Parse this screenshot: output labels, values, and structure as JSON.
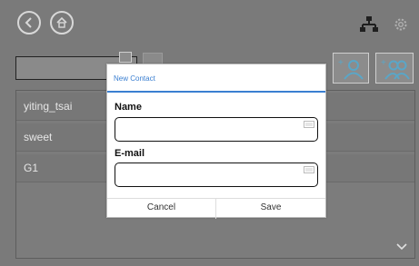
{
  "icons": {
    "back": "back-icon",
    "home": "home-icon",
    "network": "network-icon",
    "settings": "gear-icon",
    "add_contact": "add-user-icon",
    "add_group": "add-group-icon",
    "scroll": "chevron-down-icon"
  },
  "contacts": [
    {
      "name": "yiting_tsai"
    },
    {
      "name": "sweet"
    },
    {
      "name": "G1"
    }
  ],
  "dialog": {
    "title": "New Contact",
    "name_label": "Name",
    "name_value": "",
    "email_label": "E-mail",
    "email_value": "",
    "cancel_label": "Cancel",
    "save_label": "Save"
  },
  "colors": {
    "accent": "#3a7fd1",
    "overlay": "#7a7a7a",
    "dialog_bg": "#ffffff"
  }
}
